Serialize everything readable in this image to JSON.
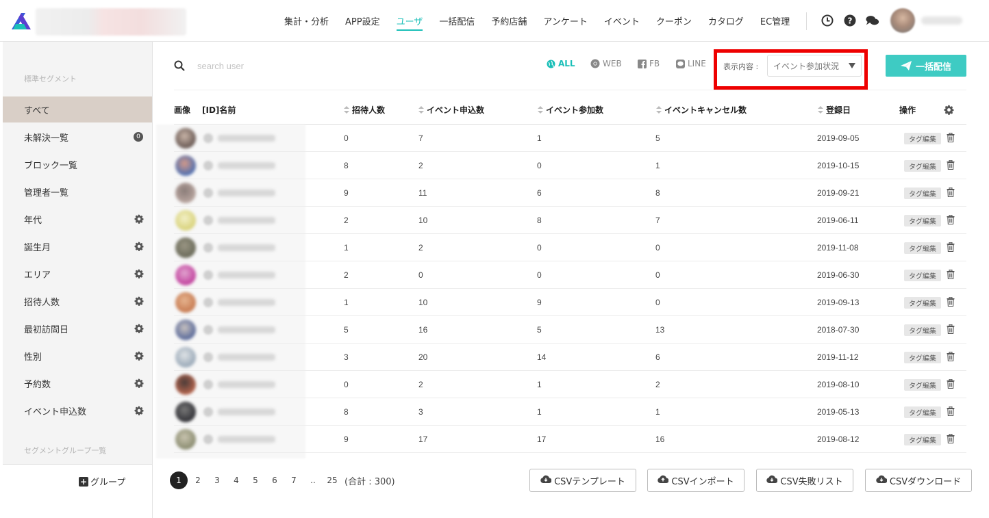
{
  "nav": {
    "items": [
      "集計・分析",
      "APP設定",
      "ユーザ",
      "一括配信",
      "予約店舗",
      "アンケート",
      "イベント",
      "クーポン",
      "カタログ",
      "EC管理"
    ],
    "active_index": 2
  },
  "header_icons": [
    "clock-icon",
    "help-icon",
    "chat-icon"
  ],
  "sidebar": {
    "section_standard": "標準セグメント",
    "items": [
      {
        "label": "すべて",
        "active": true
      },
      {
        "label": "未解決一覧",
        "badge": "0"
      },
      {
        "label": "ブロック一覧"
      },
      {
        "label": "管理者一覧"
      },
      {
        "label": "年代",
        "gear": true
      },
      {
        "label": "誕生月",
        "gear": true
      },
      {
        "label": "エリア",
        "gear": true
      },
      {
        "label": "招待人数",
        "gear": true
      },
      {
        "label": "最初訪問日",
        "gear": true
      },
      {
        "label": "性別",
        "gear": true
      },
      {
        "label": "予約数",
        "gear": true
      },
      {
        "label": "イベント申込数",
        "gear": true
      }
    ],
    "section_group": "セグメントグループ一覧",
    "group_button": "グループ"
  },
  "toolbar": {
    "search_placeholder": "search user",
    "filters": [
      "ALL",
      "WEB",
      "FB",
      "LINE"
    ],
    "display_label": "表示内容 :",
    "display_value": "イベント参加状況",
    "bulk_button": "一括配信"
  },
  "table": {
    "headers": {
      "image": "画像",
      "name": "[ID]名前",
      "invites": "招待人数",
      "event_apply": "イベント申込数",
      "event_attend": "イベント参加数",
      "event_cancel": "イベントキャンセル数",
      "registered": "登録日",
      "actions": "操作"
    },
    "tag_label": "タグ編集",
    "rows": [
      {
        "invites": "0",
        "apply": "7",
        "attend": "1",
        "cancel": "5",
        "date": "2019-09-05"
      },
      {
        "invites": "8",
        "apply": "2",
        "attend": "0",
        "cancel": "1",
        "date": "2019-10-15"
      },
      {
        "invites": "9",
        "apply": "11",
        "attend": "6",
        "cancel": "8",
        "date": "2019-09-21"
      },
      {
        "invites": "2",
        "apply": "10",
        "attend": "8",
        "cancel": "7",
        "date": "2019-06-11"
      },
      {
        "invites": "1",
        "apply": "2",
        "attend": "0",
        "cancel": "0",
        "date": "2019-11-08"
      },
      {
        "invites": "2",
        "apply": "0",
        "attend": "0",
        "cancel": "0",
        "date": "2019-06-30"
      },
      {
        "invites": "1",
        "apply": "10",
        "attend": "9",
        "cancel": "0",
        "date": "2019-09-13"
      },
      {
        "invites": "5",
        "apply": "16",
        "attend": "5",
        "cancel": "13",
        "date": "2018-07-30"
      },
      {
        "invites": "3",
        "apply": "20",
        "attend": "14",
        "cancel": "6",
        "date": "2019-11-12"
      },
      {
        "invites": "0",
        "apply": "2",
        "attend": "1",
        "cancel": "2",
        "date": "2019-08-10"
      },
      {
        "invites": "8",
        "apply": "3",
        "attend": "1",
        "cancel": "1",
        "date": "2019-05-13"
      },
      {
        "invites": "9",
        "apply": "17",
        "attend": "17",
        "cancel": "16",
        "date": "2019-08-12"
      }
    ]
  },
  "pagination": {
    "pages": [
      "1",
      "2",
      "3",
      "4",
      "5",
      "6",
      "7",
      "..",
      "25"
    ],
    "current": "1",
    "total": "(合計 : 300)"
  },
  "csv_buttons": [
    "CSVテンプレート",
    "CSVインポート",
    "CSV失敗リスト",
    "CSVダウンロード"
  ],
  "colors": {
    "accent": "#1bbfb8",
    "button": "#3ecbc3",
    "highlight": "#ee0000",
    "sidebar_active": "#d9cfc7"
  }
}
